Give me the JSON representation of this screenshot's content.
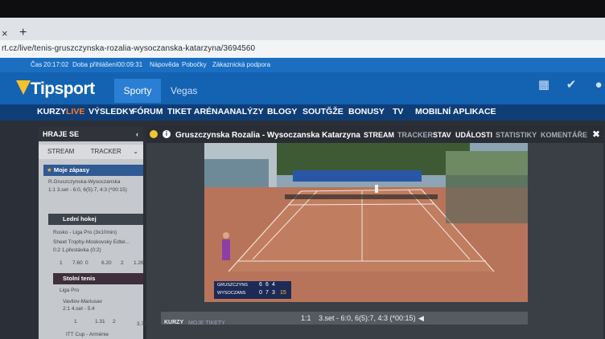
{
  "browser": {
    "tab_close": "×",
    "tab_new": "+",
    "url": "rt.cz/live/tenis-gruszczynska-rozalia-wysoczanska-katarzyna/3694560"
  },
  "infobar": {
    "time_label": "Čas",
    "time": "20:17:02",
    "login_label": "Doba přihlášení",
    "login_time": "00:09:31",
    "help": "Nápověda",
    "branches": "Pobočky",
    "support": "Zákaznická podpora"
  },
  "header": {
    "logo": "Tipsport",
    "tab_sporty": "Sporty",
    "tab_vegas": "Vegas"
  },
  "subnav": [
    "KURZY",
    "LIVE",
    "VÝSLEDKY",
    "FÓRUM",
    "TIKET ARÉNA",
    "ANALÝZY",
    "BLOGY",
    "SOUTĞŽE",
    "BONUSY",
    "TV",
    "MOBILNÍ APLIKACE"
  ],
  "sidebar": {
    "title": "HRAJE SE",
    "stream": "STREAM",
    "tracker": "TRACKER",
    "sections": [
      {
        "title": "Moje zápasy",
        "line1": "R.Gruszczynska-Wysoczanska",
        "line2": "1:1  3.set - 6:0, 6(5):7, 4:3 (*00:15)"
      },
      {
        "title": "Lední hokej",
        "line1": "Rusko - Liga Pro (3x10min)",
        "line2": "Sheet Trophy-Moskovsky Edtel...",
        "line3": "0:2  1.přestávka (0:2)",
        "odds": [
          "1",
          "7.60",
          "0",
          "6.20",
          "2",
          "1.26"
        ]
      },
      {
        "title": "Stolní tenis",
        "line1": "Liga Pro",
        "line2": "Vavilov-Mariusav",
        "line3": "2:1  4.set - 5:4",
        "odds": [
          "1",
          "1.31",
          "2",
          "3.70"
        ]
      },
      {
        "title": "ITT Cup - Arménie"
      }
    ]
  },
  "player": {
    "title": "Gruszczynska Rozalia - Wysoczanska Katarzyna",
    "tabs": [
      "STREAM",
      "TRACKER",
      "STAV",
      "UDÁLOSTI",
      "STATISTIKY",
      "KOMENTÁŘE"
    ],
    "score_overlay": {
      "p1": "GRUSZCZYNS",
      "p1_sets": [
        "6",
        "6",
        "4"
      ],
      "p2": "WYSOCZANS",
      "p2_sets": [
        "0",
        "7",
        "3"
      ],
      "p2_points": "15"
    },
    "status_score": "1:1",
    "status_text": "3.set - 6:0, 6(5):7, 4:3 (*00:15)",
    "bottom_tabs": [
      "KURZY",
      "MOJE TIKETY"
    ]
  },
  "colors": {
    "brand_blue": "#1462b2",
    "live_orange": "#ff7a2b",
    "court_clay": "#b8745a"
  }
}
